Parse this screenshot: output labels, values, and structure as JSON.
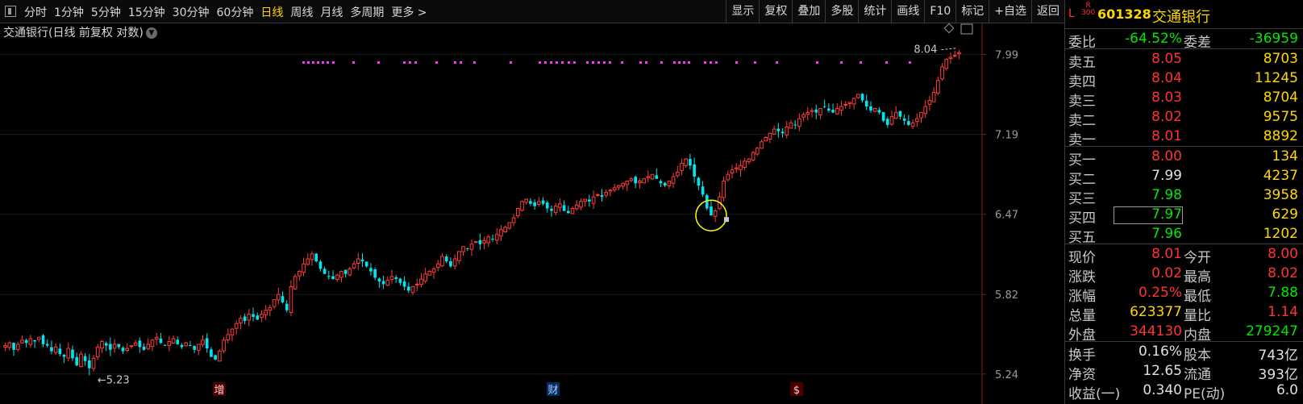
{
  "toolbar": {
    "periods": [
      "分时",
      "1分钟",
      "5分钟",
      "15分钟",
      "30分钟",
      "60分钟",
      "日线",
      "周线",
      "月线",
      "多周期",
      "更多 >"
    ],
    "active_period": 6,
    "tools": [
      "显示",
      "复权",
      "叠加",
      "多股",
      "统计",
      "画线",
      "F10",
      "标记",
      "+自选",
      "返回"
    ]
  },
  "chart": {
    "title": "交通银行(日线 前复权 对数)",
    "axis_labels": [
      "7.99",
      "7.19",
      "6.47",
      "5.82",
      "5.24"
    ],
    "high_note": "8.04",
    "low_note": "←5.23",
    "markers": [
      "增",
      "财",
      "$"
    ],
    "colors": {
      "up": "#ff3b3b",
      "down": "#00e5ee",
      "dots": "#ff33ff",
      "circle": "#ffff00"
    }
  },
  "chart_data": {
    "type": "candlestick",
    "scale": "log",
    "ylim": [
      5.2,
      8.08
    ],
    "yticks": [
      7.99,
      7.19,
      6.47,
      5.82,
      5.24
    ],
    "high": 8.04,
    "low": 5.23,
    "closes": [
      5.44,
      5.46,
      5.41,
      5.45,
      5.48,
      5.46,
      5.49,
      5.47,
      5.5,
      5.45,
      5.44,
      5.4,
      5.43,
      5.38,
      5.36,
      5.42,
      5.35,
      5.3,
      5.38,
      5.33,
      5.28,
      5.35,
      5.43,
      5.47,
      5.44,
      5.41,
      5.45,
      5.43,
      5.4,
      5.42,
      5.44,
      5.46,
      5.43,
      5.41,
      5.45,
      5.48,
      5.5,
      5.46,
      5.44,
      5.47,
      5.49,
      5.45,
      5.43,
      5.46,
      5.44,
      5.41,
      5.45,
      5.48,
      5.42,
      5.36,
      5.34,
      5.4,
      5.48,
      5.52,
      5.56,
      5.6,
      5.64,
      5.62,
      5.67,
      5.65,
      5.63,
      5.67,
      5.7,
      5.72,
      5.78,
      5.82,
      5.76,
      5.7,
      5.88,
      5.96,
      6.0,
      6.06,
      6.1,
      6.14,
      6.08,
      6.02,
      5.98,
      5.96,
      5.94,
      5.97,
      6.0,
      5.98,
      6.02,
      6.06,
      6.1,
      6.08,
      6.04,
      6.0,
      5.95,
      5.92,
      5.9,
      5.93,
      5.96,
      5.94,
      5.91,
      5.88,
      5.85,
      5.88,
      5.9,
      5.94,
      5.98,
      6.0,
      6.02,
      6.06,
      6.12,
      6.08,
      6.04,
      6.1,
      6.16,
      6.2,
      6.18,
      6.22,
      6.24,
      6.22,
      6.25,
      6.28,
      6.26,
      6.3,
      6.34,
      6.36,
      6.4,
      6.44,
      6.52,
      6.58,
      6.6,
      6.56,
      6.54,
      6.58,
      6.56,
      6.52,
      6.5,
      6.54,
      6.56,
      6.5,
      6.48,
      6.52,
      6.55,
      6.58,
      6.6,
      6.58,
      6.62,
      6.64,
      6.62,
      6.66,
      6.68,
      6.7,
      6.72,
      6.74,
      6.76,
      6.78,
      6.74,
      6.76,
      6.78,
      6.8,
      6.82,
      6.78,
      6.74,
      6.72,
      6.76,
      6.8,
      6.84,
      6.92,
      6.96,
      6.9,
      6.8,
      6.72,
      6.64,
      6.52,
      6.46,
      6.5,
      6.62,
      6.76,
      6.82,
      6.86,
      6.88,
      6.9,
      6.94,
      6.96,
      7.02,
      7.06,
      7.12,
      7.16,
      7.2,
      7.24,
      7.22,
      7.2,
      7.26,
      7.3,
      7.28,
      7.34,
      7.38,
      7.4,
      7.42,
      7.4,
      7.44,
      7.46,
      7.42,
      7.4,
      7.44,
      7.46,
      7.48,
      7.5,
      7.54,
      7.58,
      7.52,
      7.46,
      7.42,
      7.44,
      7.4,
      7.32,
      7.28,
      7.36,
      7.4,
      7.36,
      7.32,
      7.28,
      7.3,
      7.34,
      7.4,
      7.46,
      7.52,
      7.6,
      7.72,
      7.86,
      7.94,
      7.96,
      7.98,
      8.01
    ]
  },
  "quote": {
    "market_mark": "L",
    "index_tag": "R\n300",
    "code": "601328",
    "name": "交通银行",
    "webi": {
      "label1": "委比",
      "value1": "-64.52%",
      "label2": "委差",
      "value2": "-36959"
    },
    "asks": [
      {
        "label": "卖五",
        "price": "8.05",
        "vol": "8703"
      },
      {
        "label": "卖四",
        "price": "8.04",
        "vol": "11245"
      },
      {
        "label": "卖三",
        "price": "8.03",
        "vol": "8704"
      },
      {
        "label": "卖二",
        "price": "8.02",
        "vol": "9575"
      },
      {
        "label": "卖一",
        "price": "8.01",
        "vol": "8892"
      }
    ],
    "bids": [
      {
        "label": "买一",
        "price": "8.00",
        "vol": "134"
      },
      {
        "label": "买二",
        "price": "7.99",
        "vol": "4237"
      },
      {
        "label": "买三",
        "price": "7.98",
        "vol": "3958"
      },
      {
        "label": "买四",
        "price": "7.97",
        "vol": "629"
      },
      {
        "label": "买五",
        "price": "7.96",
        "vol": "1202"
      }
    ],
    "stats": [
      {
        "l1": "现价",
        "v1": "8.01",
        "l2": "今开",
        "v2": "8.00"
      },
      {
        "l1": "涨跌",
        "v1": "0.02",
        "l2": "最高",
        "v2": "8.02"
      },
      {
        "l1": "涨幅",
        "v1": "0.25%",
        "l2": "最低",
        "v2": "7.88"
      },
      {
        "l1": "总量",
        "v1": "623377",
        "l2": "量比",
        "v2": "1.14"
      },
      {
        "l1": "外盘",
        "v1": "344130",
        "l2": "内盘",
        "v2": "279247"
      }
    ],
    "fund": [
      {
        "l1": "换手",
        "v1": "0.16%",
        "l2": "股本",
        "v2": "743亿"
      },
      {
        "l1": "净资",
        "v1": "12.65",
        "l2": "流通",
        "v2": "393亿"
      },
      {
        "l1": "收益(一)",
        "v1": "0.340",
        "l2": "PE(动)",
        "v2": "6.0"
      }
    ]
  }
}
